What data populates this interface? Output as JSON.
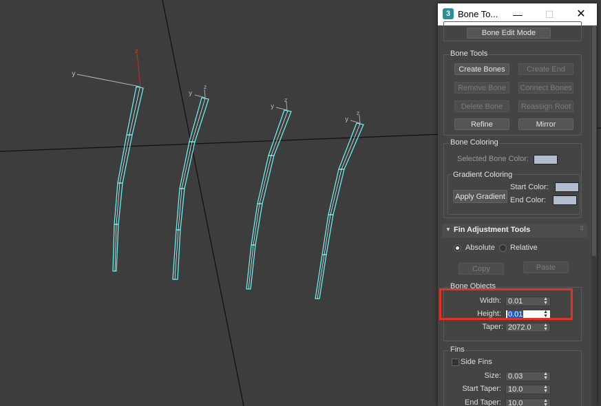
{
  "viewport": {
    "axis_labels": {
      "x": "y",
      "z": "z"
    }
  },
  "window": {
    "title": "Bone To...",
    "app_icon": "3ds-max-icon",
    "controls": {
      "minimize": "—",
      "maximize": "☐",
      "close": "✕"
    }
  },
  "bone_edit_mode_label": "Bone Edit Mode",
  "bone_tools": {
    "label": "Bone Tools",
    "create_bones": "Create Bones",
    "create_end": "Create End",
    "remove_bone": "Remove Bone",
    "connect_bones": "Connect Bones",
    "delete_bone": "Delete Bone",
    "reassign_root": "Reassign Root",
    "refine": "Refine",
    "mirror": "Mirror"
  },
  "bone_coloring": {
    "label": "Bone Coloring",
    "selected_bone_color": "Selected Bone Color:",
    "gradient_label": "Gradient Coloring",
    "apply_gradient": "Apply Gradient",
    "start_color": "Start Color:",
    "end_color": "End Color:",
    "swatch_color": "#b4bcd0"
  },
  "fin_adjustment": {
    "title": "Fin Adjustment Tools",
    "absolute": "Absolute",
    "relative": "Relative",
    "copy": "Copy",
    "paste": "Paste"
  },
  "bone_objects": {
    "label": "Bone Objects",
    "width_label": "Width:",
    "width_value": "0.01",
    "height_label": "Height:",
    "height_value": "0.01",
    "taper_label": "Taper:",
    "taper_value": "2072.0"
  },
  "fins": {
    "label": "Fins",
    "side_fins": "Side Fins",
    "size_label": "Size:",
    "size_value": "0.03",
    "start_taper_label": "Start Taper:",
    "start_taper_value": "10.0",
    "end_taper_label": "End Taper:",
    "end_taper_value": "10.0"
  },
  "colors": {
    "highlight": "#e8321f",
    "bone": "#5ff2f2",
    "z_axis": "#c0302a"
  }
}
